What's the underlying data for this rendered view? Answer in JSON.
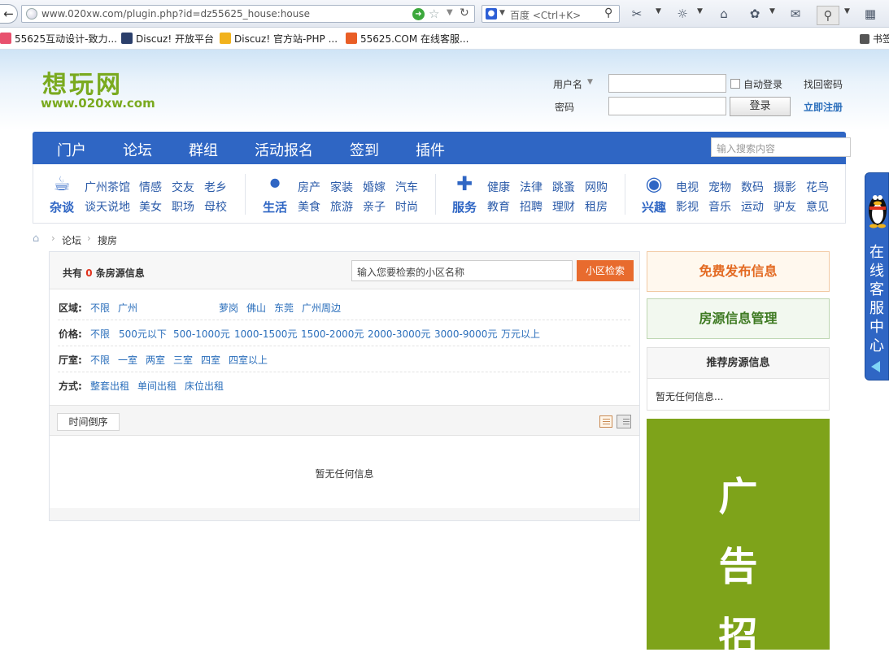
{
  "browser": {
    "url": "www.020xw.com/plugin.php?id=dz55625_house:house",
    "search_placeholder": "百度 <Ctrl+K>",
    "bookmarks": [
      "55625互动设计-致力...",
      "Discuz! 开放平台",
      "Discuz! 官方站-PHP ...",
      "55625.COM 在线客服..."
    ],
    "bookmarks_right": "书签"
  },
  "header": {
    "logo_cn": "想玩网",
    "logo_url": "www.020xw.com",
    "username_label": "用户名",
    "password_label": "密码",
    "auto_login": "自动登录",
    "forgot": "找回密码",
    "login": "登录",
    "register": "立即注册"
  },
  "nav": {
    "items": [
      "门户",
      "论坛",
      "群组",
      "活动报名",
      "签到",
      "插件"
    ],
    "search_placeholder": "输入搜索内容"
  },
  "categories": [
    {
      "title": "杂谈",
      "links": [
        "广州茶馆",
        "情感",
        "交友",
        "老乡",
        "谈天说地",
        "美女",
        "职场",
        "母校"
      ]
    },
    {
      "title": "生活",
      "links": [
        "房产",
        "家装",
        "婚嫁",
        "汽车",
        "美食",
        "旅游",
        "亲子",
        "时尚"
      ]
    },
    {
      "title": "服务",
      "links": [
        "健康",
        "法律",
        "跳蚤",
        "网购",
        "教育",
        "招聘",
        "理财",
        "租房"
      ]
    },
    {
      "title": "兴趣",
      "links": [
        "电视",
        "宠物",
        "数码",
        "摄影",
        "花鸟",
        "影视",
        "音乐",
        "运动",
        "驴友",
        "意见"
      ]
    }
  ],
  "breadcrumb": {
    "forum": "论坛",
    "current": "搜房"
  },
  "listing": {
    "count_prefix": "共有",
    "count": "0",
    "count_suffix": "条房源信息",
    "estate_search_placeholder": "输入您要检索的小区名称",
    "estate_search_button": "小区检索",
    "filters": {
      "area": {
        "label": "区域:",
        "options": [
          "不限",
          "广州",
          "萝岗",
          "佛山",
          "东莞",
          "广州周边"
        ]
      },
      "price": {
        "label": "价格:",
        "options": [
          "不限",
          "500元以下",
          "500-1000元",
          "1000-1500元",
          "1500-2000元",
          "2000-3000元",
          "3000-9000元",
          "万元以上"
        ]
      },
      "rooms": {
        "label": "厅室:",
        "options": [
          "不限",
          "一室",
          "两室",
          "三室",
          "四室",
          "四室以上"
        ]
      },
      "mode": {
        "label": "方式:",
        "options": [
          "整套出租",
          "单间出租",
          "床位出租"
        ]
      }
    },
    "sort_label": "时间倒序",
    "empty": "暂无任何信息"
  },
  "sidebar": {
    "publish": "免费发布信息",
    "manage": "房源信息管理",
    "recommend_title": "推荐房源信息",
    "recommend_empty": "暂无任何信息...",
    "ad_chars": [
      "广",
      "告",
      "招"
    ]
  },
  "service": {
    "text": "在线客服中心"
  },
  "colors": {
    "nav_blue": "#2f66c4",
    "accent_orange": "#e86b2e",
    "ad_green": "#7ea31a",
    "count_red": "#e0321d"
  }
}
